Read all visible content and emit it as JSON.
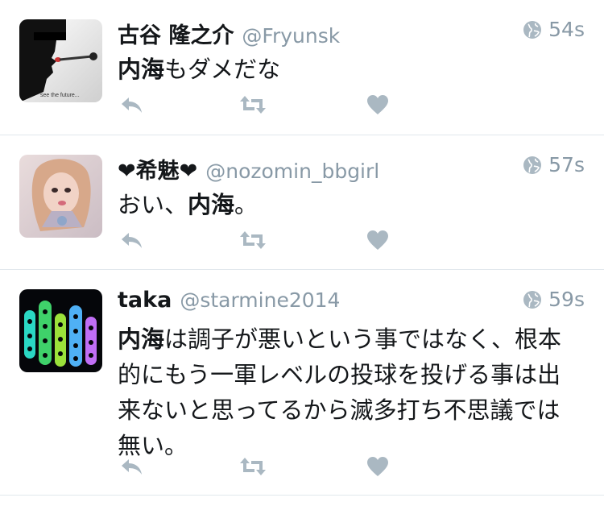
{
  "colors": {
    "name": "#14171a",
    "secondary": "#8899a6",
    "action_icon": "#aab8c2",
    "divider": "#e1e8ed"
  },
  "tweets": [
    {
      "display_name": "古谷 隆之介",
      "handle": "@Fryunsk",
      "time": "54s",
      "text_bold": "内海",
      "text_rest": "もダメだな",
      "avatar_caption": "see the future..."
    },
    {
      "display_name": "❤希魅❤",
      "handle": "@nozomin_bbgirl",
      "time": "57s",
      "text_pre": "おい、",
      "text_bold": "内海",
      "text_post": "。"
    },
    {
      "display_name": "taka",
      "handle": "@starmine2014",
      "time": "59s",
      "text_bold": "内海",
      "text_line1_rest": "は調子が悪いという事ではなく、根本",
      "text_line2": "的にもう一軍レベルの投球を投げる事は出",
      "text_line3": "来ないと思ってるから滅多打ち不思議では",
      "text_line4": "無い。"
    }
  ],
  "icons": {
    "reply": "reply-icon",
    "retweet": "retweet-icon",
    "like": "heart-icon",
    "privacy": "globe-icon"
  }
}
